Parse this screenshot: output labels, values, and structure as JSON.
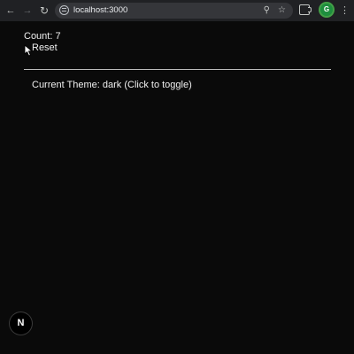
{
  "browser": {
    "back_icon": "←",
    "forward_icon": "→",
    "reload_icon": "↻",
    "url": "localhost:3000",
    "zoom_icon": "⚲",
    "star_icon": "☆",
    "profile_initial": "G",
    "menu_icon": "⋮"
  },
  "app": {
    "count_text": "Count: 7",
    "reset_label": "Reset",
    "theme_text": "Current Theme: dark (Click to toggle)"
  },
  "dev_indicator": {
    "label": "N"
  },
  "colors": {
    "page_background": "#0a0a0a",
    "text": "#f0f0f0",
    "divider": "#bcbcbc",
    "chrome_background": "#202124",
    "omnibox_background": "#35363a",
    "avatar": "#1e8e3e"
  }
}
